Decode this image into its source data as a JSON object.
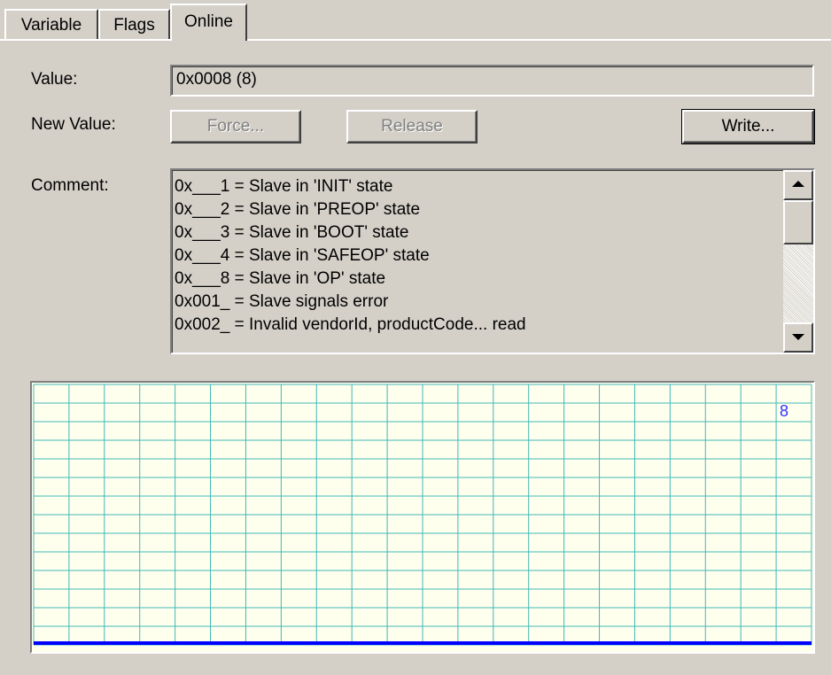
{
  "tabs": [
    {
      "label": "Variable",
      "active": false
    },
    {
      "label": "Flags",
      "active": false
    },
    {
      "label": "Online",
      "active": true
    }
  ],
  "value": {
    "label": "Value:",
    "text": "0x0008 (8)"
  },
  "new_value": {
    "label": "New Value:",
    "force_label": "Force...",
    "release_label": "Release",
    "write_label": "Write..."
  },
  "comment": {
    "label": "Comment:",
    "lines": [
      "0x___1 = Slave in 'INIT' state",
      "0x___2 = Slave in 'PREOP' state",
      "0x___3 = Slave in 'BOOT' state",
      "0x___4 = Slave in 'SAFEOP' state",
      "0x___8 = Slave in 'OP' state",
      "0x001_ = Slave signals error",
      "0x002_ = Invalid vendorId, productCode... read"
    ]
  },
  "icons": {
    "scroll_up": "arrow-up-icon",
    "scroll_down": "arrow-down-icon"
  },
  "colors": {
    "window_bg": "#d4d0c8",
    "chart_bg": "#ffffee",
    "grid": "#40b8b8",
    "trace": "#0000ff",
    "value_label": "#3333ff"
  },
  "chart_data": {
    "type": "line",
    "current_value_label": "8",
    "series": [
      {
        "values": [
          0,
          0
        ]
      }
    ],
    "grid": true
  }
}
